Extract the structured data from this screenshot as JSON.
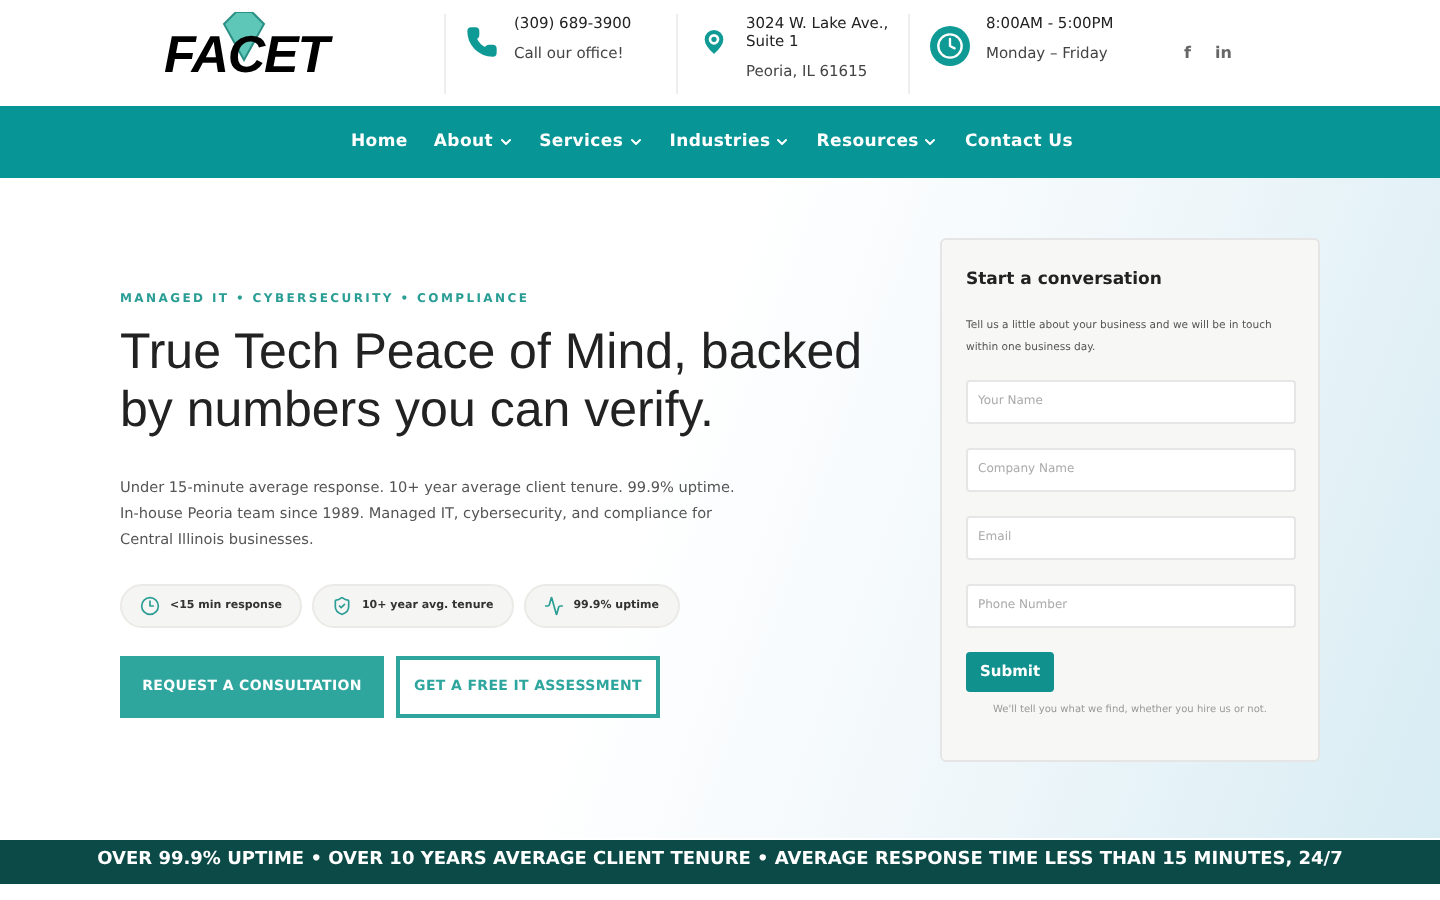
{
  "header": {
    "logo": "FACET",
    "contacts": [
      {
        "kind": "phone",
        "line1": "(309) 689-3900",
        "line2": "Call our office!"
      },
      {
        "kind": "location",
        "line1": "3024 W. Lake Ave., Suite 1",
        "line2": "Peoria, IL 61615"
      },
      {
        "kind": "clock",
        "line1": "8:00AM - 5:00PM",
        "line2": "Monday – Friday"
      }
    ],
    "social": [
      {
        "label": "f"
      },
      {
        "label": "in"
      }
    ]
  },
  "nav": [
    {
      "label": "Home",
      "has_menu": false
    },
    {
      "label": "About",
      "has_menu": true
    },
    {
      "label": "Services",
      "has_menu": true
    },
    {
      "label": "Industries",
      "has_menu": true
    },
    {
      "label": "Resources",
      "has_menu": true
    },
    {
      "label": "Contact Us",
      "has_menu": false
    }
  ],
  "hero": {
    "eyebrow": "MANAGED IT • CYBERSECURITY • COMPLIANCE",
    "headline": "True Tech Peace of Mind, backed by numbers you can verify.",
    "body": "Under 15-minute average response. 10+ year average client tenure. 99.9% uptime. In-house Peoria team since 1989. Managed IT, cybersecurity, and compliance for Central Illinois businesses.",
    "badges": [
      {
        "kind": "clock",
        "label": "<15 min response"
      },
      {
        "kind": "shield",
        "label": "10+ year avg. tenure"
      },
      {
        "kind": "pulse",
        "label": "99.9% uptime"
      }
    ],
    "buttons": [
      {
        "kind": "primary",
        "label": "REQUEST A CONSULTATION"
      },
      {
        "kind": "outline",
        "label": "GET A FREE IT ASSESSMENT"
      }
    ]
  },
  "form": {
    "title": "Start a conversation",
    "intro": "Tell us a little about your business and we will be in touch within one business day.",
    "fields": [
      {
        "placeholder": "Your Name"
      },
      {
        "placeholder": "Company Name"
      },
      {
        "placeholder": "Email"
      },
      {
        "placeholder": "Phone Number"
      }
    ],
    "submit": "Submit",
    "note": "We'll tell you what we find, whether you hire us or not."
  },
  "banner": "OVER 99.9% UPTIME • OVER 10 YEARS AVERAGE CLIENT TENURE • AVERAGE RESPONSE TIME LESS THAN 15 MINUTES, 24/7"
}
